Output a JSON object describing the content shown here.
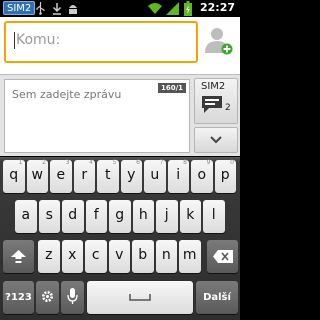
{
  "status_bar": {
    "sim_label": "SIM2",
    "time": "22:27",
    "icons": [
      "usb-icon",
      "download-icon",
      "android-debug-icon",
      "wifi-icon",
      "signal-icon",
      "battery-charging-icon"
    ]
  },
  "recipient": {
    "placeholder": "Komu:",
    "add_contact_icon": "add-contact-icon"
  },
  "compose": {
    "placeholder": "Sem zadejte zprávu",
    "char_counter": "160/1",
    "send_button": {
      "label": "SIM2",
      "sim_number": "2",
      "icon": "send-message-icon"
    },
    "expand_icon": "chevron-down-icon"
  },
  "keyboard": {
    "row1": [
      {
        "key": "q",
        "sub": "1"
      },
      {
        "key": "w",
        "sub": "2"
      },
      {
        "key": "e",
        "sub": "3"
      },
      {
        "key": "r",
        "sub": "4"
      },
      {
        "key": "t",
        "sub": "5"
      },
      {
        "key": "y",
        "sub": "6"
      },
      {
        "key": "u",
        "sub": "7"
      },
      {
        "key": "i",
        "sub": "8"
      },
      {
        "key": "o",
        "sub": "9"
      },
      {
        "key": "p",
        "sub": "0"
      }
    ],
    "row2": [
      "a",
      "s",
      "d",
      "f",
      "g",
      "h",
      "j",
      "k",
      "l"
    ],
    "row3": [
      "z",
      "x",
      "c",
      "v",
      "b",
      "n",
      "m"
    ],
    "shift_icon": "shift-icon",
    "backspace_icon": "backspace-icon",
    "symbols_label": "?123",
    "settings_icon": "gear-icon",
    "mic_icon": "microphone-icon",
    "space_icon": "space-icon",
    "action_label": "Další"
  }
}
